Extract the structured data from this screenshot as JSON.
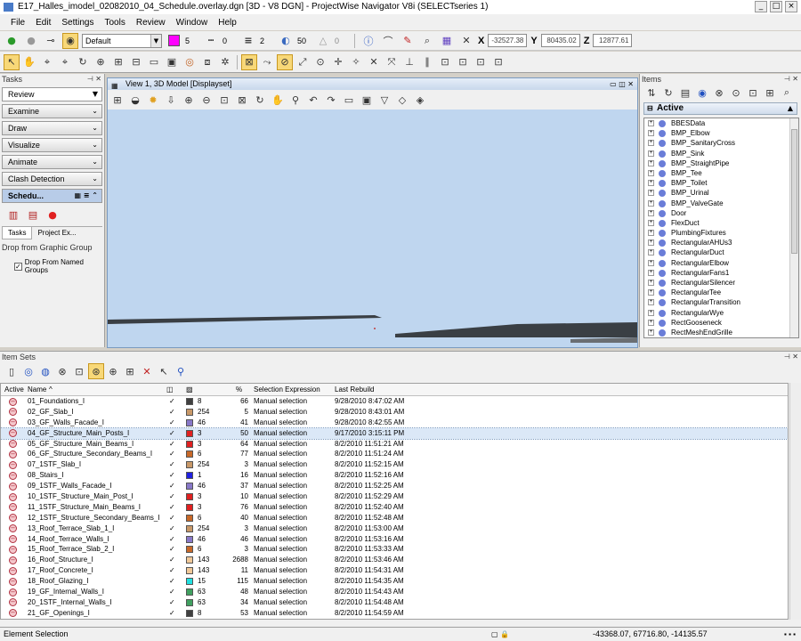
{
  "window": {
    "title": "E17_Halles_imodel_02082010_04_Schedule.overlay.dgn [3D - V8 DGN] - ProjectWise Navigator V8i (SELECTseries 1)"
  },
  "menu": [
    "File",
    "Edit",
    "Settings",
    "Tools",
    "Review",
    "Window",
    "Help"
  ],
  "toolbar1": {
    "level": "Default",
    "color_num": "5",
    "style_num": "0",
    "weight_num": "2",
    "transparency": "50",
    "priority": "0",
    "x_label": "X",
    "x_value": "-32527.38",
    "y_label": "Y",
    "y_value": "80435.02",
    "z_label": "Z",
    "z_value": "12877.61",
    "color_swatch": "#ff00ff"
  },
  "tasks": {
    "header": "Tasks",
    "combo": "Review",
    "buttons": [
      "Examine",
      "Draw",
      "Visualize",
      "Animate",
      "Clash Detection"
    ],
    "schedule": "Schedu...",
    "tabs": [
      "Tasks",
      "Project Ex..."
    ],
    "drop_header": "Drop from Graphic Group",
    "drop_option": "Drop From Named Groups"
  },
  "view": {
    "title": "View 1, 3D Model [Displayset]",
    "bg": "#bfd6ef"
  },
  "items": {
    "header": "Items",
    "active_label": "Active",
    "tree": [
      "BBESData",
      "BMP_Elbow",
      "BMP_SanitaryCross",
      "BMP_Sink",
      "BMP_StraightPipe",
      "BMP_Tee",
      "BMP_Toilet",
      "BMP_Urinal",
      "BMP_ValveGate",
      "Door",
      "FlexDuct",
      "PlumbingFixtures",
      "RectangularAHUs3",
      "RectangularDuct",
      "RectangularElbow",
      "RectangularFans1",
      "RectangularSilencer",
      "RectangularTee",
      "RectangularTransition",
      "RectangularWye",
      "RectGooseneck",
      "RectMeshEndGrille"
    ]
  },
  "itemsets": {
    "header": "Item Sets",
    "columns": {
      "active": "Active",
      "name": "Name",
      "sel_expr": "Selection Expression",
      "last_rebuild": "Last Rebuild"
    },
    "rows": [
      {
        "name": "01_Foundations_I",
        "color": "#404040",
        "cnum": "8",
        "count": "66",
        "expr": "Manual selection",
        "date": "9/28/2010 8:47:02 AM"
      },
      {
        "name": "02_GF_Slab_I",
        "color": "#c89868",
        "cnum": "254",
        "count": "5",
        "expr": "Manual selection",
        "date": "9/28/2010 8:43:01 AM"
      },
      {
        "name": "03_GF_Walls_Facade_I",
        "color": "#8878c8",
        "cnum": "46",
        "count": "41",
        "expr": "Manual selection",
        "date": "9/28/2010 8:42:55 AM"
      },
      {
        "name": "04_GF_Structure_Main_Posts_I",
        "color": "#e02020",
        "cnum": "3",
        "count": "50",
        "expr": "Manual selection",
        "date": "9/17/2010 3:15:11 PM"
      },
      {
        "name": "05_GF_Structure_Main_Beams_I",
        "color": "#e02020",
        "cnum": "3",
        "count": "64",
        "expr": "Manual selection",
        "date": "8/2/2010 11:51:21 AM"
      },
      {
        "name": "06_GF_Structure_Secondary_Beams_I",
        "color": "#c86828",
        "cnum": "6",
        "count": "77",
        "expr": "Manual selection",
        "date": "8/2/2010 11:51:24 AM"
      },
      {
        "name": "07_1STF_Slab_I",
        "color": "#c89868",
        "cnum": "254",
        "count": "3",
        "expr": "Manual selection",
        "date": "8/2/2010 11:52:15 AM"
      },
      {
        "name": "08_Stairs_I",
        "color": "#2020e0",
        "cnum": "1",
        "count": "16",
        "expr": "Manual selection",
        "date": "8/2/2010 11:52:16 AM"
      },
      {
        "name": "09_1STF_Walls_Facade_I",
        "color": "#8878c8",
        "cnum": "46",
        "count": "37",
        "expr": "Manual selection",
        "date": "8/2/2010 11:52:25 AM"
      },
      {
        "name": "10_1STF_Structure_Main_Post_I",
        "color": "#e02020",
        "cnum": "3",
        "count": "10",
        "expr": "Manual selection",
        "date": "8/2/2010 11:52:29 AM"
      },
      {
        "name": "11_1STF_Structure_Main_Beams_I",
        "color": "#e02020",
        "cnum": "3",
        "count": "76",
        "expr": "Manual selection",
        "date": "8/2/2010 11:52:40 AM"
      },
      {
        "name": "12_1STF_Structure_Secondary_Beams_I",
        "color": "#c86828",
        "cnum": "6",
        "count": "40",
        "expr": "Manual selection",
        "date": "8/2/2010 11:52:48 AM"
      },
      {
        "name": "13_Roof_Terrace_Slab_1_I",
        "color": "#c89868",
        "cnum": "254",
        "count": "3",
        "expr": "Manual selection",
        "date": "8/2/2010 11:53:00 AM"
      },
      {
        "name": "14_Roof_Terrace_Walls_I",
        "color": "#8878c8",
        "cnum": "46",
        "count": "46",
        "expr": "Manual selection",
        "date": "8/2/2010 11:53:16 AM"
      },
      {
        "name": "15_Roof_Terrace_Slab_2_I",
        "color": "#c86828",
        "cnum": "6",
        "count": "3",
        "expr": "Manual selection",
        "date": "8/2/2010 11:53:33 AM"
      },
      {
        "name": "16_Roof_Structure_I",
        "color": "#f0c898",
        "cnum": "143",
        "count": "2688",
        "expr": "Manual selection",
        "date": "8/2/2010 11:53:46 AM"
      },
      {
        "name": "17_Roof_Concrete_I",
        "color": "#f0c898",
        "cnum": "143",
        "count": "11",
        "expr": "Manual selection",
        "date": "8/2/2010 11:54:31 AM"
      },
      {
        "name": "18_Roof_Glazing_I",
        "color": "#20e0e0",
        "cnum": "15",
        "count": "115",
        "expr": "Manual selection",
        "date": "8/2/2010 11:54:35 AM"
      },
      {
        "name": "19_GF_Internal_Walls_I",
        "color": "#40a060",
        "cnum": "63",
        "count": "48",
        "expr": "Manual selection",
        "date": "8/2/2010 11:54:43 AM"
      },
      {
        "name": "20_1STF_Internal_Walls_I",
        "color": "#40a060",
        "cnum": "63",
        "count": "34",
        "expr": "Manual selection",
        "date": "8/2/2010 11:54:48 AM"
      },
      {
        "name": "21_GF_Openings_I",
        "color": "#404040",
        "cnum": "8",
        "count": "53",
        "expr": "Manual selection",
        "date": "8/2/2010 11:54:59 AM"
      }
    ]
  },
  "status": {
    "left": "Element Selection",
    "coords": "-43368.07, 67716.80, -14135.57"
  }
}
